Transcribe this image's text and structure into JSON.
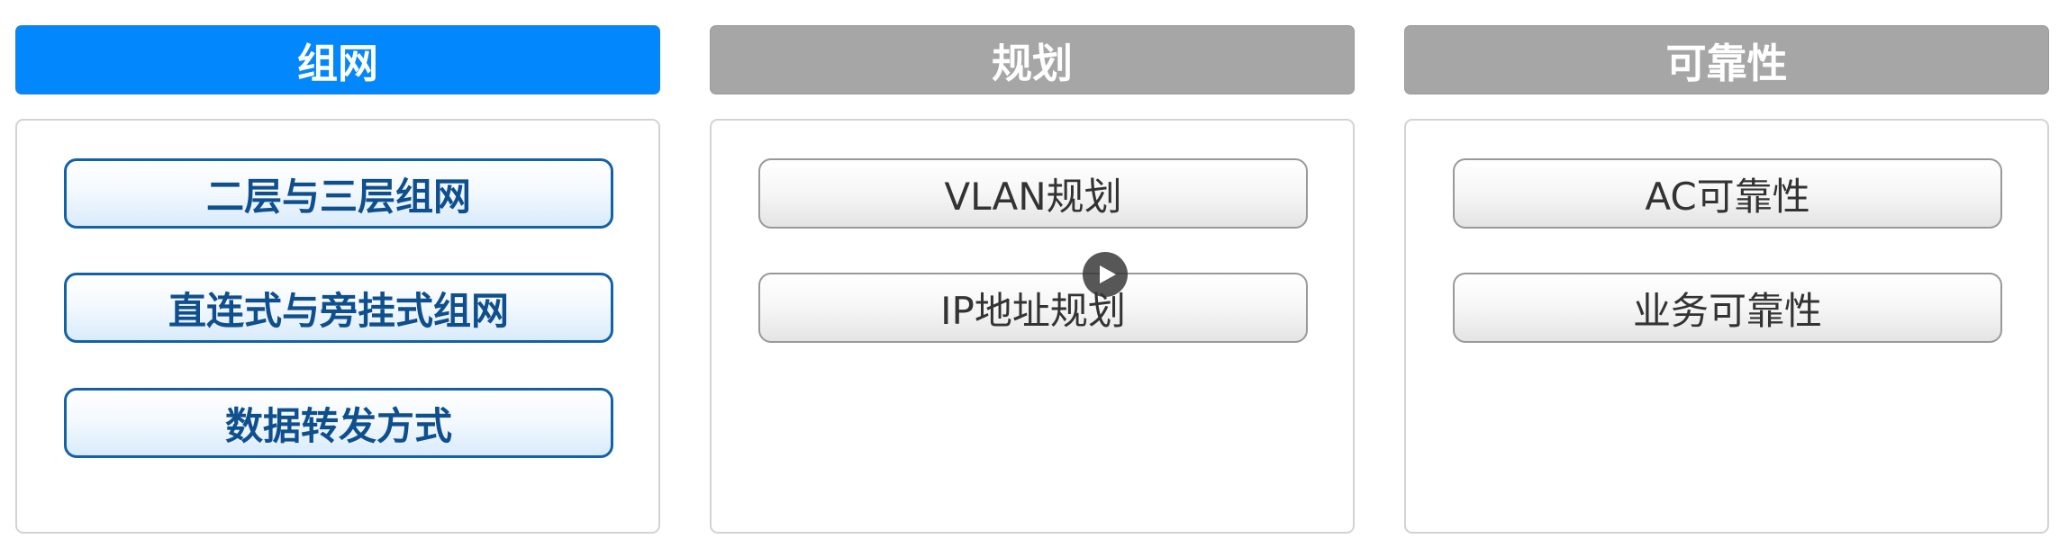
{
  "tabs": [
    {
      "label": "组网",
      "state": "active"
    },
    {
      "label": "规划",
      "state": "inactive"
    },
    {
      "label": "可靠性",
      "state": "inactive"
    }
  ],
  "panels": [
    {
      "items": [
        "二层与三层组网",
        "直连式与旁挂式组网",
        "数据转发方式"
      ]
    },
    {
      "items": [
        "VLAN规划",
        "IP地址规划"
      ]
    },
    {
      "items": [
        "AC可靠性",
        "业务可靠性"
      ]
    }
  ],
  "colors": {
    "active_tab": "#0287fc",
    "inactive_tab": "#a6a6a6",
    "active_item_text": "#0f4f8e",
    "inactive_item_text": "#333333"
  },
  "overlay": {
    "icon": "play-icon"
  }
}
